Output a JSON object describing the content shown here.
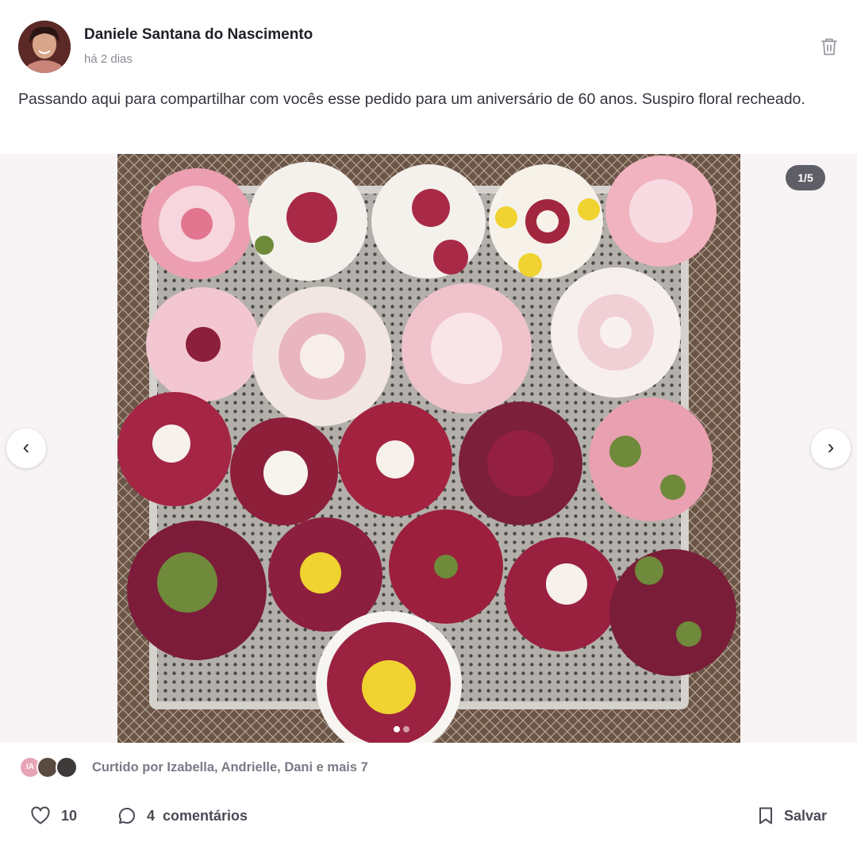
{
  "post": {
    "author": "Daniele Santana do Nascimento",
    "timestamp": "há 2 dias",
    "text": "Passando aqui para compartilhar com vocês esse pedido para um aniversário de 60 anos. Suspiro floral recheado."
  },
  "media": {
    "counter": "1/5",
    "prev_label": "‹",
    "next_label": "›",
    "current_index": 1,
    "total": 5
  },
  "likes": {
    "avatars": [
      {
        "initials": "IA",
        "color": "#e6a4b4"
      },
      {
        "initials": "",
        "color": "#5a4a40"
      },
      {
        "initials": "",
        "color": "#3f3a3a"
      }
    ],
    "text": "Curtido por Izabella, Andrielle, Dani e mais 7"
  },
  "actions": {
    "like_count": "10",
    "comment_count": "4",
    "comment_label": "comentários",
    "save_label": "Salvar"
  },
  "icons": {
    "delete": "trash-icon",
    "like": "heart-icon",
    "comment": "comment-bubble-icon",
    "save": "bookmark-icon"
  },
  "colors": {
    "background": "#ffffff",
    "crimson": "#9b2240",
    "pink": "#e58aa0",
    "cream": "#f6f1ea",
    "yellow": "#f0d230",
    "green": "#6e8a3a",
    "tray": "#a9a7a4"
  }
}
